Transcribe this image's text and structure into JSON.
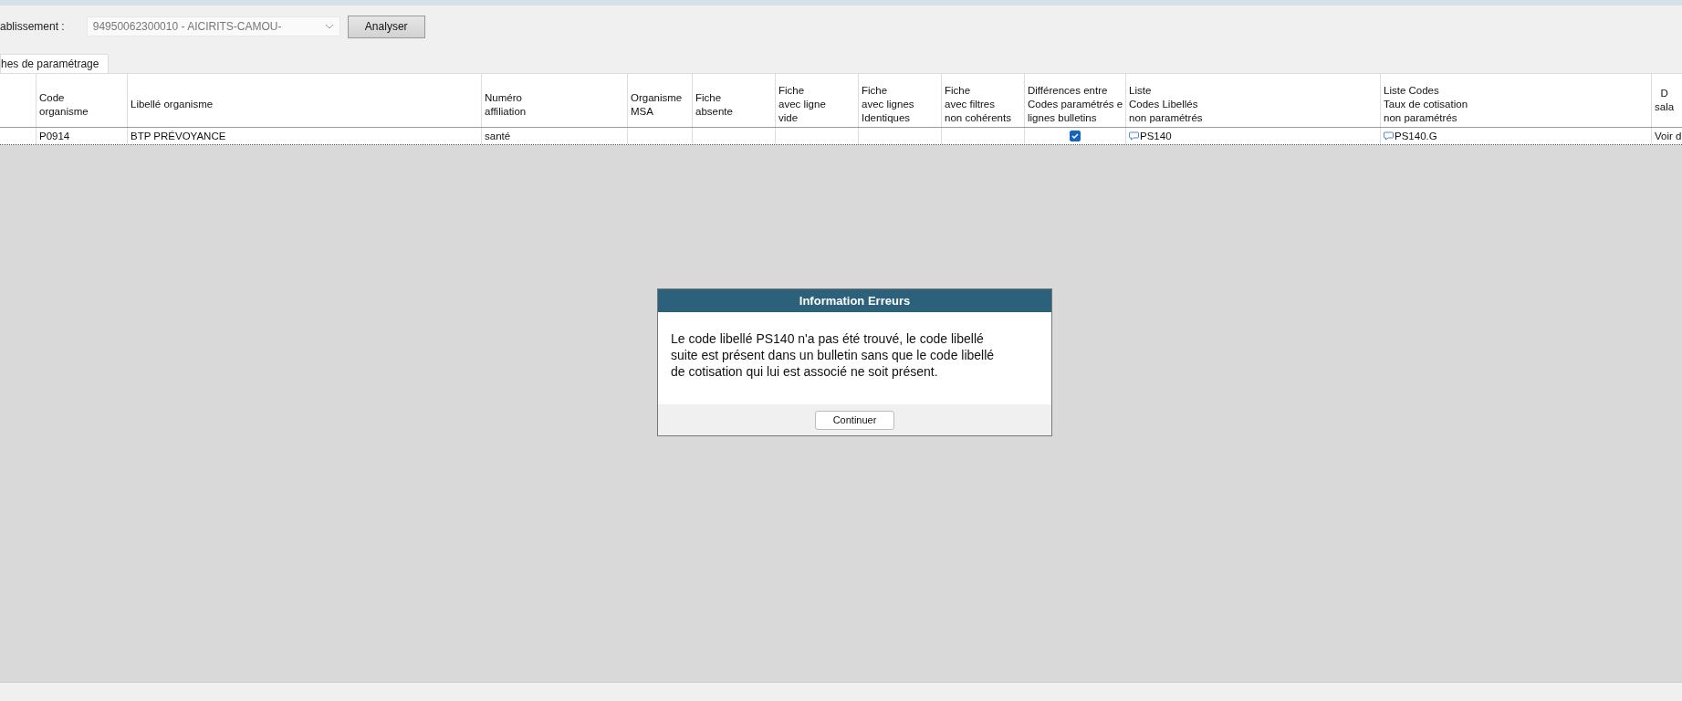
{
  "toolbar": {
    "label": "ablissement :",
    "establishment": {
      "value": "94950062300010 - AICIRITS-CAMOU-"
    },
    "analyze_button": "Analyser"
  },
  "tabs": [
    {
      "label": "hes de paramétrage",
      "selected": true
    }
  ],
  "table": {
    "columns": [
      {},
      {
        "lines": [
          "Code",
          "organisme"
        ]
      },
      {
        "lines": [
          "Libellé organisme"
        ]
      },
      {
        "lines": [
          "Numéro",
          "affiliation"
        ]
      },
      {
        "lines": [
          "Organisme",
          "MSA"
        ]
      },
      {
        "lines": [
          "Fiche",
          "absente"
        ]
      },
      {
        "lines": [
          "Fiche",
          "avec ligne",
          "vide"
        ]
      },
      {
        "lines": [
          "Fiche",
          "avec lignes",
          "Identiques"
        ]
      },
      {
        "lines": [
          "Fiche",
          "avec filtres",
          "non cohérents"
        ]
      },
      {
        "lines": [
          "Différences entre",
          "Codes paramétrés e",
          "lignes bulletins"
        ]
      },
      {
        "lines": [
          "Liste",
          "Codes Libellés",
          "non paramétrés"
        ]
      },
      {
        "lines": [
          "Liste Codes",
          "Taux de cotisation",
          "non paramétrés"
        ]
      },
      {
        "lines": [
          "D",
          "sala"
        ]
      }
    ],
    "rows": [
      {
        "cells": [
          {
            "kind": "text",
            "text": ""
          },
          {
            "kind": "text",
            "text": "P0914"
          },
          {
            "kind": "text",
            "text": "BTP PRÉVOYANCE"
          },
          {
            "kind": "text",
            "text": "santé"
          },
          {
            "kind": "text",
            "text": ""
          },
          {
            "kind": "text",
            "text": ""
          },
          {
            "kind": "text",
            "text": ""
          },
          {
            "kind": "text",
            "text": ""
          },
          {
            "kind": "text",
            "text": ""
          },
          {
            "kind": "check",
            "checked": true
          },
          {
            "kind": "comment",
            "text": "PS140"
          },
          {
            "kind": "comment",
            "text": "PS140.G"
          },
          {
            "kind": "text",
            "text": "Voir d"
          }
        ]
      }
    ]
  },
  "dialog": {
    "title": "Information Erreurs",
    "message": "Le code libellé PS140 n'a pas été trouvé, le code libellé suite est présent dans un bulletin sans que le code libellé de cotisation qui lui est associé ne soit présent.",
    "button": "Continuer"
  }
}
